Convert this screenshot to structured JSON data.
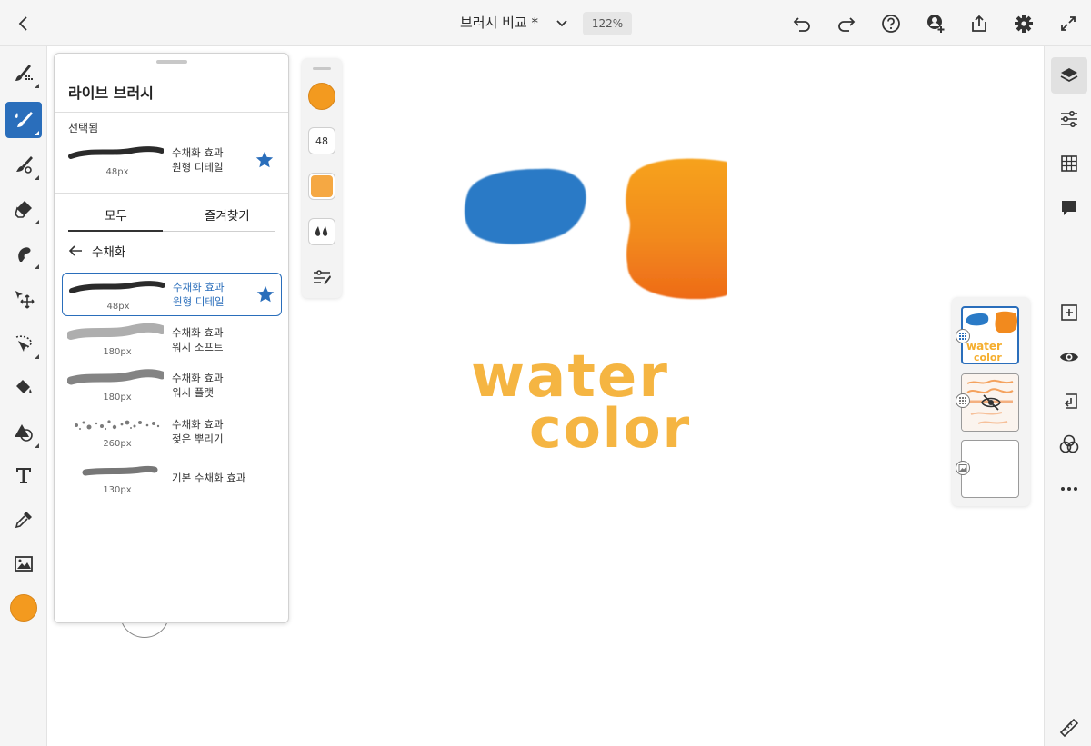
{
  "header": {
    "doc_title": "브러시 비교 *",
    "zoom": "122%"
  },
  "colors": {
    "accent": "#2a6ebb",
    "current_color": "#f39a1f",
    "water_blue": "#2a7ac6",
    "water_orange": "#f28a1e"
  },
  "panel": {
    "title": "라이브 브러시",
    "selected_label": "선택됨",
    "selected_brush": {
      "line1": "수채화 효과",
      "line2": "원형 디테일",
      "size": "48px"
    },
    "tabs": [
      "모두",
      "즐겨찾기"
    ],
    "breadcrumb": "수채화",
    "brushes": [
      {
        "line1": "수채화 효과",
        "line2": "원형 디테일",
        "size": "48px",
        "favorite": true
      },
      {
        "line1": "수채화 효과",
        "line2": "워시 소프트",
        "size": "180px",
        "favorite": false
      },
      {
        "line1": "수채화 효과",
        "line2": "워시 플랫",
        "size": "180px",
        "favorite": false
      },
      {
        "line1": "수채화 효과",
        "line2": "젖은 뿌리기",
        "size": "260px",
        "favorite": false
      },
      {
        "line1": "기본 수채화 효과",
        "line2": "",
        "size": "130px",
        "favorite": false
      }
    ]
  },
  "minibar": {
    "size_value": "48"
  },
  "canvas_text": {
    "word1": "water",
    "word2": "color"
  }
}
